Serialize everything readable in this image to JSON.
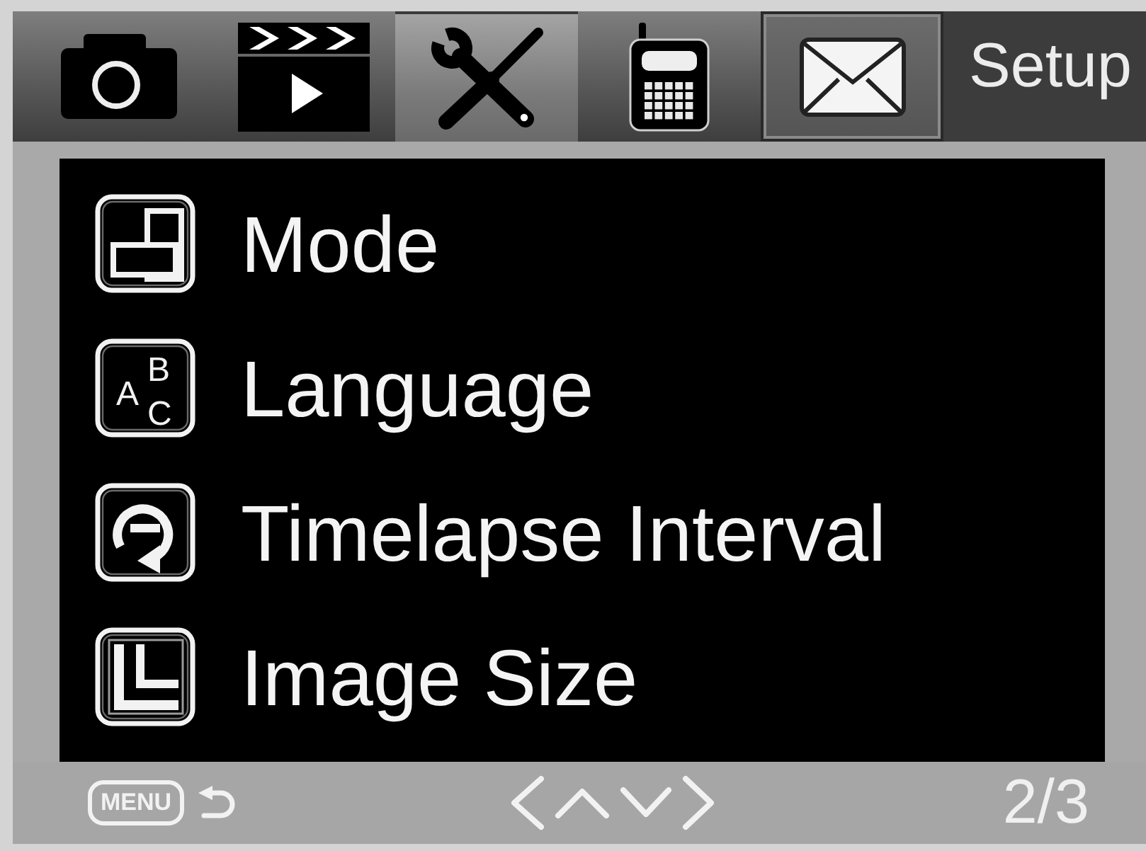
{
  "tabs": [
    {
      "selected": false,
      "focused": false
    },
    {
      "selected": false,
      "focused": false
    },
    {
      "selected": true,
      "focused": false
    },
    {
      "selected": false,
      "focused": false
    },
    {
      "selected": false,
      "focused": true
    }
  ],
  "title": "Setup",
  "menu_items": [
    {
      "label": "Mode"
    },
    {
      "label": "Language",
      "icon_letters": [
        "A",
        "B",
        "C"
      ]
    },
    {
      "label": "Timelapse Interval"
    },
    {
      "label": "Image Size"
    }
  ],
  "footer": {
    "menu_key": "MENU",
    "page": "2/3"
  }
}
